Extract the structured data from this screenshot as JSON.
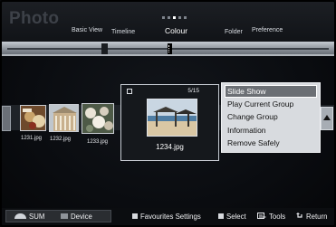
{
  "app": {
    "title": "Photo"
  },
  "header": {
    "tabs": [
      "Basic View",
      "Timeline",
      "Colour",
      "Folder",
      "Preference"
    ],
    "active_tab": "Colour"
  },
  "focused_item": {
    "filename": "1234.jpg",
    "counter": "5/15"
  },
  "thumbnails": [
    {
      "filename": "1231.jpg"
    },
    {
      "filename": "1232.jpg"
    },
    {
      "filename": "1233.jpg"
    }
  ],
  "context_menu": {
    "items": [
      "Slide Show",
      "Play Current Group",
      "Change Group",
      "Information",
      "Remove Safely"
    ],
    "selected": "Slide Show"
  },
  "footer": {
    "sum_label": "SUM",
    "device_label": "Device",
    "favourites_label": "Favourites Settings",
    "select_label": "Select",
    "tools_label": "Tools",
    "return_label": "Return"
  },
  "colors": {
    "menu_bg": "#d8dbdf",
    "menu_selected": "#6b6f74",
    "background": "#0a0c10"
  }
}
